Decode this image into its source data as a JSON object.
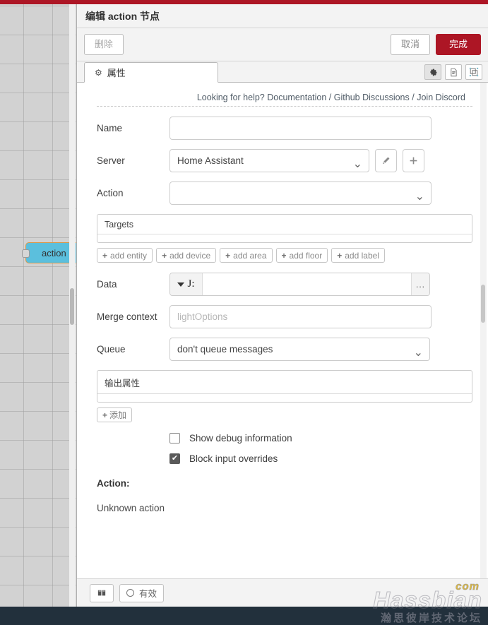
{
  "canvas": {
    "node_label": "action"
  },
  "dialog": {
    "title": "编辑 action 节点",
    "delete_label": "删除",
    "cancel_label": "取消",
    "done_label": "完成",
    "done_color": "#ad1625"
  },
  "tabs": {
    "properties_label": "属性",
    "gear_icon": "gear-icon",
    "icons": [
      {
        "name": "settings-icon",
        "glyph": "gear"
      },
      {
        "name": "description-icon",
        "glyph": "document"
      },
      {
        "name": "appearance-icon",
        "glyph": "layout"
      }
    ]
  },
  "help": {
    "prefix": "Looking for help?",
    "documentation": "Documentation",
    "sep1": "/",
    "github": "Github Discussions",
    "sep2": "/",
    "discord": "Join Discord"
  },
  "form": {
    "name": {
      "label": "Name",
      "value": "",
      "placeholder": ""
    },
    "server": {
      "label": "Server",
      "value": "Home Assistant",
      "options": [
        "Home Assistant"
      ],
      "edit_icon": "pencil-icon",
      "add_icon": "plus-icon"
    },
    "action": {
      "label": "Action",
      "value": "",
      "placeholder": ""
    },
    "targets": {
      "header": "Targets",
      "chips": [
        {
          "label": "add entity"
        },
        {
          "label": "add device"
        },
        {
          "label": "add area"
        },
        {
          "label": "add floor"
        },
        {
          "label": "add label"
        }
      ],
      "plus": "+"
    },
    "data": {
      "label": "Data",
      "type_token": "J:",
      "value": "",
      "placeholder": "",
      "expand_glyph": "..."
    },
    "merge_context": {
      "label": "Merge context",
      "value": "",
      "placeholder": "lightOptions"
    },
    "queue": {
      "label": "Queue",
      "value": "don't queue messages",
      "options": [
        "don't queue messages"
      ]
    },
    "output_properties": {
      "header": "输出属性",
      "add_label": "添加",
      "plus": "+"
    },
    "show_debug": {
      "label": "Show debug information",
      "checked": false
    },
    "block_input": {
      "label": "Block input overrides",
      "checked": true
    },
    "action_section": {
      "title": "Action:",
      "text": "Unknown action"
    }
  },
  "footer": {
    "book_icon": "book-icon",
    "enabled_label": "有效",
    "enabled_icon": "circle-icon"
  },
  "watermark": {
    "main": "Hassbian",
    "com": "com",
    "sub": "瀚思彼岸技术论坛"
  }
}
